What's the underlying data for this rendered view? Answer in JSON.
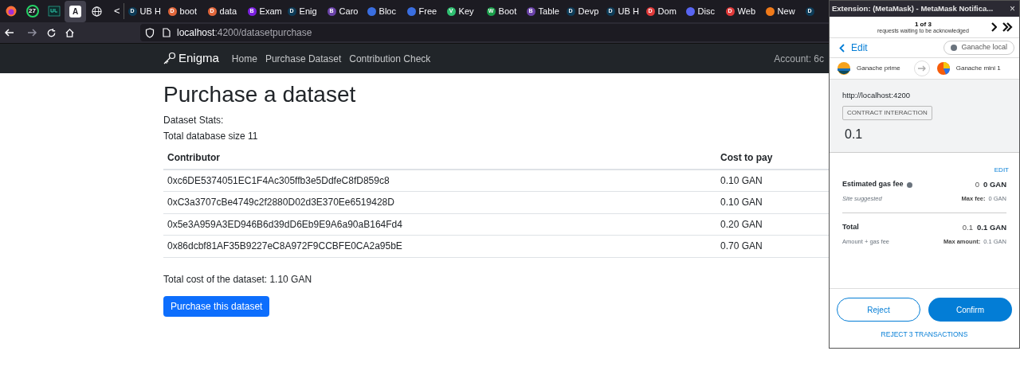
{
  "browser": {
    "pinned_tabs": [
      {
        "kind": "firefox",
        "selected": false
      },
      {
        "kind": "whatsapp",
        "badge": "27",
        "selected": false
      },
      {
        "kind": "ub",
        "selected": false
      },
      {
        "kind": "angular",
        "letter": "A",
        "selected": true
      },
      {
        "kind": "globe",
        "selected": false
      }
    ],
    "scroll_left": "<",
    "tabs": [
      {
        "label": "UB H",
        "letter": "D",
        "color": "#0d3b57"
      },
      {
        "label": "boot",
        "letter": "D",
        "color": "#e0653a"
      },
      {
        "label": "data",
        "letter": "D",
        "color": "#e0653a"
      },
      {
        "label": "Exam",
        "letter": "B",
        "color": "#7b1fe0"
      },
      {
        "label": "Enig",
        "letter": "D",
        "color": "#0d3b57"
      },
      {
        "label": "Caro",
        "letter": "B",
        "color": "#6a42a8"
      },
      {
        "label": "Bloc",
        "color": "#3a6ee0"
      },
      {
        "label": "Free",
        "color": "#3a6ee0"
      },
      {
        "label": "Key",
        "letter": "V",
        "color": "#2fbf71"
      },
      {
        "label": "Boot",
        "letter": "W",
        "color": "#1a9e4a"
      },
      {
        "label": "Table",
        "letter": "B",
        "color": "#6a42a8"
      },
      {
        "label": "Devp",
        "letter": "D",
        "color": "#0d3b57"
      },
      {
        "label": "UB H",
        "letter": "D",
        "color": "#0d3b57"
      },
      {
        "label": "Dom",
        "letter": "D",
        "color": "#e03a3a"
      },
      {
        "label": "Disc",
        "color": "#5865f2"
      },
      {
        "label": "Web",
        "letter": "D",
        "color": "#e03a3a"
      },
      {
        "label": "New",
        "color": "#f07a1a"
      },
      {
        "letter": "D",
        "color": "#0d3b57"
      }
    ],
    "url_host": "localhost",
    "url_rest": ":4200/datasetpurchase"
  },
  "navbar": {
    "brand": "Enigma",
    "links": [
      "Home",
      "Purchase Dataset",
      "Contribution Check"
    ],
    "account": "Account: 6c"
  },
  "page": {
    "title": "Purchase a dataset",
    "stats_label": "Dataset Stats:",
    "size_text": "Total database size 11",
    "table": {
      "columns": [
        "Contributor",
        "Cost to pay"
      ],
      "rows": [
        [
          "0xc6DE5374051EC1F4Ac305ffb3e5DdfeC8fD859c8",
          "0.10 GAN"
        ],
        [
          "0xC3a3707cBe4749c2f2880D02d3E370Ee6519428D",
          "0.10 GAN"
        ],
        [
          "0x5e3A959A3ED946B6d39dD6Eb9E9A6a90aB164Fd4",
          "0.20 GAN"
        ],
        [
          "0x86dcbf81AF35B9227eC8A972F9CCBFE0CA2a95bE",
          "0.70 GAN"
        ]
      ]
    },
    "total_text": "Total cost of the dataset: 1.10 GAN",
    "button": "Purchase this dataset"
  },
  "popup": {
    "window_title": "Extension: (MetaMask) - MetaMask Notifica...",
    "close": "×",
    "counter": "1 of 3",
    "counter_note": "requests waiting to be acknowledged",
    "back_label": "Edit",
    "network": "Ganache local",
    "from": "Ganache prime",
    "to": "Ganache mini 1",
    "origin": "http://localhost:4200",
    "badge": "CONTRACT INTERACTION",
    "amount": "0.1",
    "edit_link": "EDIT",
    "gas": {
      "label": "Estimated gas fee",
      "value_plain": "0",
      "value_bold": "0 GAN",
      "note": "Site suggested",
      "max_label": "Max fee:",
      "max_value": "0 GAN"
    },
    "total": {
      "label": "Total",
      "value_plain": "0.1",
      "value_bold": "0.1 GAN",
      "note": "Amount + gas fee",
      "max_label": "Max amount:",
      "max_value": "0.1 GAN"
    },
    "buttons": [
      {
        "label": "Reject",
        "kind": "outline"
      },
      {
        "label": "Confirm",
        "kind": "primary"
      }
    ],
    "reject_all": "REJECT 3 TRANSACTIONS"
  }
}
